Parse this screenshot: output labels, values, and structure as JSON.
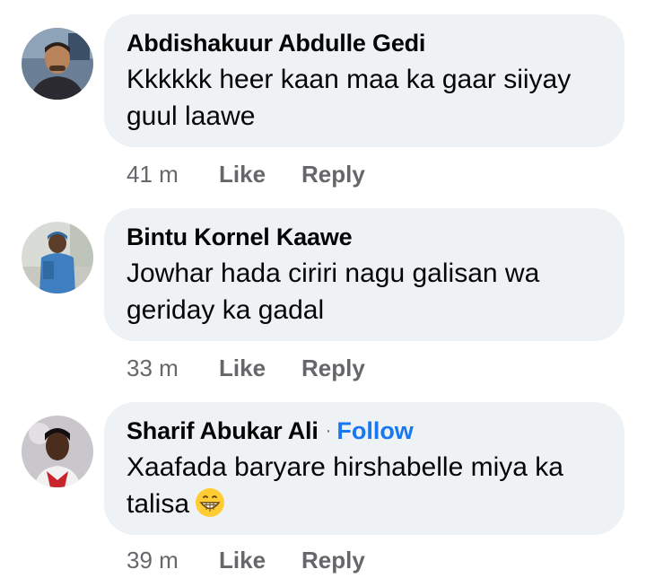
{
  "comments": [
    {
      "author": "Abdishakuur Abdulle Gedi",
      "text": "Kkkkkk heer kaan maa ka gaar siiyay\nguul laawe",
      "time": "41 m",
      "like_label": "Like",
      "reply_label": "Reply"
    },
    {
      "author": "Bintu Kornel Kaawe",
      "text": "Jowhar hada ciriri nagu galisan wa\ngeriday ka gadal",
      "time": "33 m",
      "like_label": "Like",
      "reply_label": "Reply"
    },
    {
      "author": "Sharif Abukar Ali",
      "separator": "·",
      "follow_label": "Follow",
      "text": "Xaafada baryare hirshabelle miya ka\ntalisa",
      "emoji": "grinning-face-emoji",
      "time": "39 m",
      "like_label": "Like",
      "reply_label": "Reply"
    }
  ],
  "colors": {
    "bubble": "#eff2f5",
    "follow": "#1877f2",
    "meta": "#65676b"
  }
}
